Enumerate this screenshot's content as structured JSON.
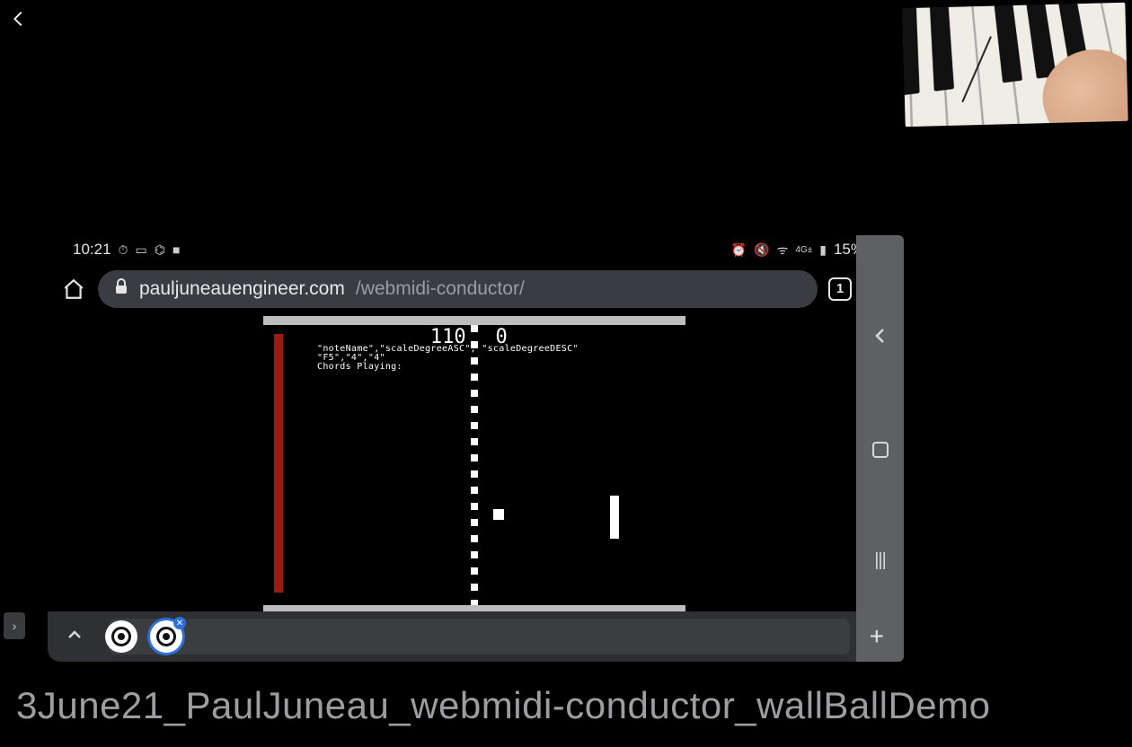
{
  "outer_window": {
    "caption": "3June21_PaulJuneau_webmidi-conductor_wallBallDemo"
  },
  "phone": {
    "status": {
      "time": "10:21",
      "battery_pct": "15%"
    },
    "address": {
      "domain": "pauljuneauengineer.com",
      "path": "/webmidi-conductor/",
      "tab_count": "1"
    },
    "game": {
      "score_left": "110",
      "score_right": "0",
      "debug_line1": "\"noteName\",\"scaleDegreeASC\", \"scaleDegreeDESC\"",
      "debug_line2": "\"F5\",\"4\",\"4\"",
      "debug_line3": "Chords Playing:"
    },
    "bottom_bar": {
      "badge_text": "✕"
    }
  }
}
